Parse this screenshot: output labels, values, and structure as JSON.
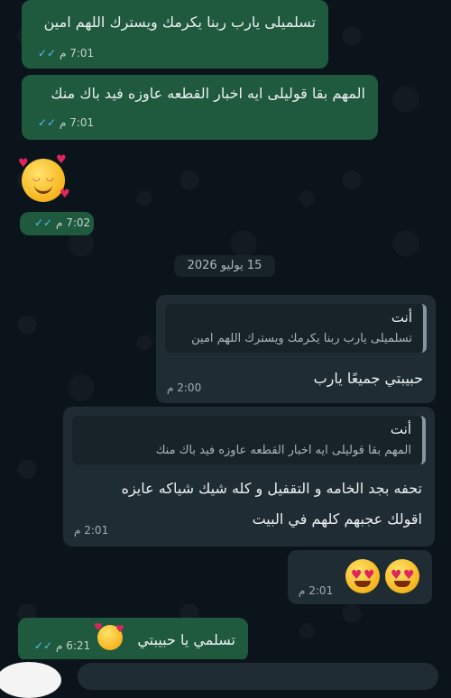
{
  "messages": [
    {
      "text": "تسلميلى يارب ربنا يكرمك ويسترك اللهم امين",
      "time": "7:01 م"
    },
    {
      "text": "المهم بقا قوليلى ايه اخبار القطعه عاوزه فيد باك منك",
      "time": "7:01 م"
    },
    {
      "emoji": "smiling-face-with-hearts",
      "time": "7:02 م"
    }
  ],
  "date_chip": "15 يوليو 2026",
  "replies": [
    {
      "quote_author": "أنت",
      "quote_text": "تسلميلى يارب ربنا يكرمك ويسترك اللهم امين",
      "text": "حبيبتي جميعًا يارب",
      "time": "2:00 م"
    },
    {
      "quote_author": "أنت",
      "quote_text": "المهم بقا قوليلى ايه اخبار القطعه عاوزه فيد باك منك",
      "line1": "تحفه بجد الخامه و التقفيل و كله شيك شياكه عايزه",
      "line2": "اقولك عجبهم كلهم في البيت",
      "time": "2:01 م"
    },
    {
      "emoji": "heart-eyes-x2",
      "time": "2:01 م"
    }
  ],
  "last_message": {
    "text": "تسلمي يا حبيبتي",
    "time": "6:21 م"
  },
  "colors": {
    "outgoing": "#1f5a3f",
    "incoming": "#1f2c33",
    "ticks": "#53bdeb"
  }
}
